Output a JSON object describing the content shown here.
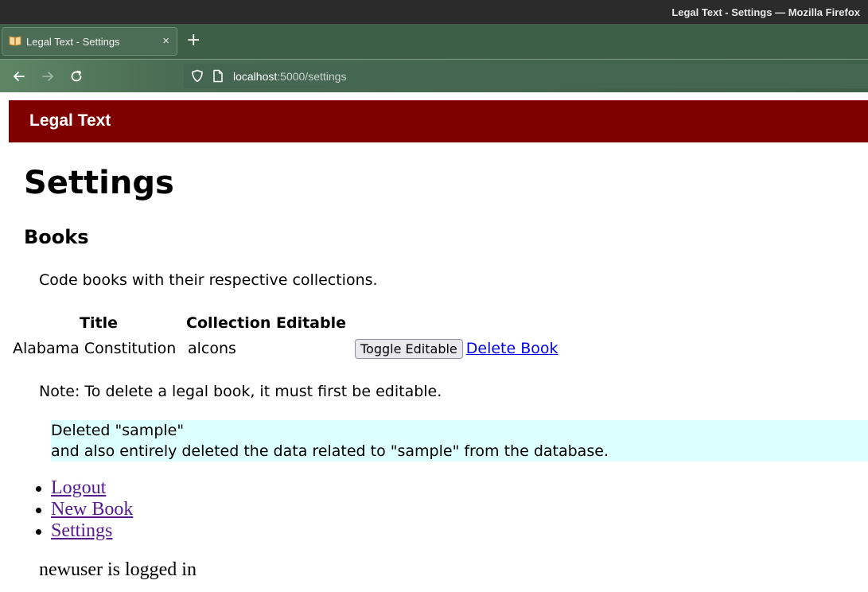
{
  "window": {
    "title": "Legal Text - Settings — Mozilla Firefox"
  },
  "browser": {
    "tab_title": "Legal Text - Settings",
    "tab_close": "×",
    "new_tab": "+",
    "url_host": "localhost",
    "url_rest": ":5000/settings"
  },
  "site": {
    "name": "Legal Text",
    "header_color": "#800000"
  },
  "main": {
    "heading": "Settings",
    "section_heading": "Books",
    "description": "Code books with their respective collections.",
    "table": {
      "headers": [
        "Title",
        "Collection",
        "Editable"
      ],
      "rows": [
        {
          "title": "Alabama Constitution",
          "collection": "alcons",
          "toggle_label": "Toggle Editable",
          "delete_label": "Delete Book"
        }
      ]
    },
    "note": "Note: To delete a legal book, it must first be editable.",
    "flash": {
      "line1": "Deleted \"sample\"",
      "line2": "and also entirely deleted the data related to \"sample\" from the database.",
      "background": "#dcffff"
    }
  },
  "menu": {
    "items": [
      {
        "label": "Logout"
      },
      {
        "label": "New Book"
      },
      {
        "label": "Settings"
      }
    ]
  },
  "footer": {
    "status": "newuser is logged in"
  }
}
